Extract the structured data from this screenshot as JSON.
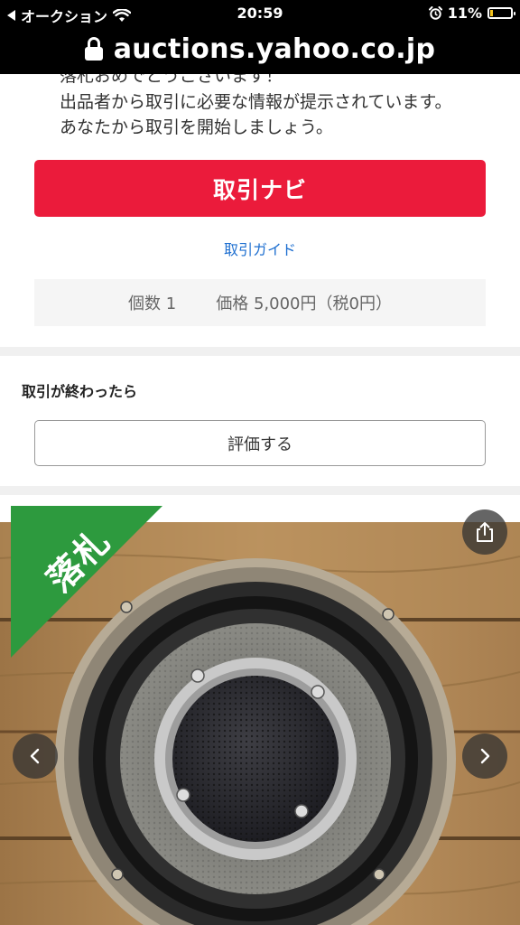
{
  "status_bar": {
    "back_app": "オークション",
    "time": "20:59",
    "battery": "11%"
  },
  "browser": {
    "url": "auctions.yahoo.co.jp"
  },
  "message": {
    "line1": "落札おめでとうございます！",
    "line2": "出品者から取引に必要な情報が提示されています。",
    "line3": "あなたから取引を開始しましょう。"
  },
  "actions": {
    "navi_label": "取引ナビ",
    "guide_label": "取引ガイド"
  },
  "summary": {
    "quantity": "個数 1",
    "price": "価格 5,000円（税0円）"
  },
  "review": {
    "heading": "取引が終わったら",
    "button_label": "評価する"
  },
  "photo": {
    "badge_label": "落札",
    "share_icon": "share-icon",
    "prev_icon": "chevron-left-icon",
    "next_icon": "chevron-right-icon"
  },
  "colors": {
    "accent_red": "#eb1b3b",
    "link_blue": "#1e6fd0",
    "badge_green": "#2d9a3e"
  }
}
